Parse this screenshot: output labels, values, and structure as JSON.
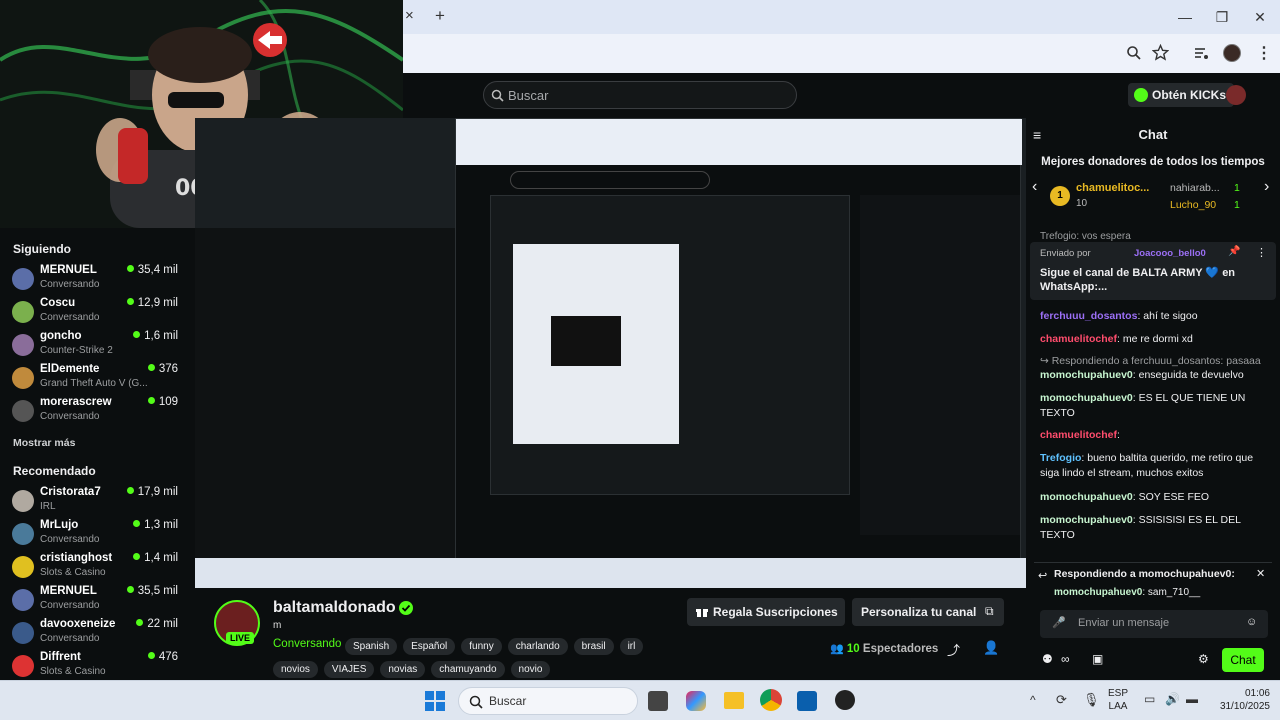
{
  "browser": {
    "new_tab": "+",
    "close_tab": "×",
    "win_min": "—",
    "win_max": "❐",
    "win_close": "✕"
  },
  "kick": {
    "search_placeholder": "Buscar",
    "get_kicks": "Obtén KICKs"
  },
  "sidebar": {
    "following_title": "Siguiendo",
    "show_more": "Mostrar más",
    "recommended_title": "Recomendado",
    "following": [
      {
        "name": "MERNUEL",
        "game": "Conversando",
        "viewers": "35,4 mil",
        "color": "#5b6ea8"
      },
      {
        "name": "Coscu",
        "game": "Conversando",
        "viewers": "12,9 mil",
        "color": "#7bb04d"
      },
      {
        "name": "goncho",
        "game": "Counter-Strike 2",
        "viewers": "1,6 mil",
        "color": "#8a6d9a"
      },
      {
        "name": "ElDemente",
        "game": "Grand Theft Auto V (G...",
        "viewers": "376",
        "color": "#c08a3c"
      },
      {
        "name": "morerascrew",
        "game": "Conversando",
        "viewers": "109",
        "color": "#555"
      }
    ],
    "recommended": [
      {
        "name": "Cristorata7",
        "game": "IRL",
        "viewers": "17,9 mil",
        "color": "#b0a9a0"
      },
      {
        "name": "MrLujo",
        "game": "Conversando",
        "viewers": "1,3 mil",
        "color": "#4a7a9a"
      },
      {
        "name": "cristianghost",
        "game": "Slots & Casino",
        "viewers": "1,4 mil",
        "color": "#e0c020"
      },
      {
        "name": "MERNUEL",
        "game": "Conversando",
        "viewers": "35,5 mil",
        "color": "#5b6ea8"
      },
      {
        "name": "davooxeneize",
        "game": "Conversando",
        "viewers": "22 mil",
        "color": "#3a5a8a"
      },
      {
        "name": "Diffrent",
        "game": "Slots & Casino",
        "viewers": "476",
        "color": "#d33"
      }
    ]
  },
  "stream": {
    "name": "baltamaldonado",
    "title": "m",
    "category": "Conversando",
    "live": "LIVE",
    "tags": [
      "Spanish",
      "Español",
      "funny",
      "charlando",
      "brasil",
      "irl",
      "novios",
      "VIAJES",
      "novias",
      "chamuyando",
      "novio"
    ],
    "gift_subs": "Regala Suscripciones",
    "customize": "Personaliza tu canal",
    "viewers_count": "10",
    "viewers_label": "Espectadores"
  },
  "chat": {
    "title": "Chat",
    "top_donors_title": "Mejores donadores de todos los tiempos",
    "donors": [
      {
        "rank": "1",
        "name": "chamuelitoc...",
        "amount": "10"
      },
      {
        "rank": "",
        "name": "nahiarab...",
        "amount": "1"
      },
      {
        "rank": "",
        "name": "Lucho_90",
        "amount": "1"
      }
    ],
    "pinned_by_label": "Enviado por",
    "pinned_by_user": "Joacooo_bello0",
    "pinned_text": "Sigue el canal de BALTA ARMY 💙 en WhatsApp:...",
    "partial_top": "Trefogio: vos espera",
    "messages": [
      {
        "user": "ferchuuu_dosantos",
        "text": ": ahí te sigoo",
        "color": "#9b6ff5"
      },
      {
        "user": "chamuelitochef",
        "text": ": me re dormi xd",
        "color": "#ff4d6d"
      },
      {
        "user": "",
        "text": "↪ Respondiendo a ferchuuu_dosantos: pasaaa",
        "color": "#9c9ea0"
      },
      {
        "user": "momochupahuev0",
        "text": ": enseguida te devuelvo",
        "color": "#c7f5d0"
      },
      {
        "user": "momochupahuev0",
        "text": ": ES EL QUE TIENE UN TEXTO",
        "color": "#c7f5d0"
      },
      {
        "user": "chamuelitochef",
        "text": ":",
        "color": "#ff4d6d"
      },
      {
        "user": "Trefogio",
        "text": ": bueno baltita querido, me retiro que siga lindo el stream, muchos exitos",
        "color": "#5fc2ff"
      },
      {
        "user": "momochupahuev0",
        "text": ": SOY ESE FEO",
        "color": "#c7f5d0"
      },
      {
        "user": "momochupahuev0",
        "text": ": SSISISISI ES EL DEL TEXTO",
        "color": "#c7f5d0"
      }
    ],
    "replying_to": "Respondiendo a momochupahuev0:",
    "reply_preview_user": "momochupahuev0",
    "reply_preview_text": ": sam_710__",
    "input_placeholder": "Enviar un mensaje",
    "send_button": "Chat"
  },
  "taskbar": {
    "search_placeholder": "Buscar",
    "lang": "ESP",
    "region": "LAA",
    "time": "01:06",
    "date": "31/10/2025"
  },
  "colors": {
    "kick_green": "#53fc18",
    "bg": "#0b0e0f"
  }
}
